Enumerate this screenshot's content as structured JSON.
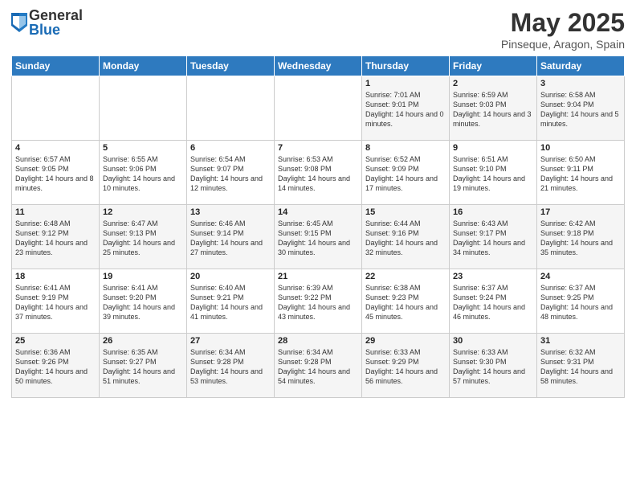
{
  "logo": {
    "general": "General",
    "blue": "Blue"
  },
  "title": "May 2025",
  "subtitle": "Pinseque, Aragon, Spain",
  "weekdays": [
    "Sunday",
    "Monday",
    "Tuesday",
    "Wednesday",
    "Thursday",
    "Friday",
    "Saturday"
  ],
  "weeks": [
    [
      {
        "day": "",
        "sunrise": "",
        "sunset": "",
        "daylight": ""
      },
      {
        "day": "",
        "sunrise": "",
        "sunset": "",
        "daylight": ""
      },
      {
        "day": "",
        "sunrise": "",
        "sunset": "",
        "daylight": ""
      },
      {
        "day": "",
        "sunrise": "",
        "sunset": "",
        "daylight": ""
      },
      {
        "day": "1",
        "sunrise": "Sunrise: 7:01 AM",
        "sunset": "Sunset: 9:01 PM",
        "daylight": "Daylight: 14 hours and 0 minutes."
      },
      {
        "day": "2",
        "sunrise": "Sunrise: 6:59 AM",
        "sunset": "Sunset: 9:03 PM",
        "daylight": "Daylight: 14 hours and 3 minutes."
      },
      {
        "day": "3",
        "sunrise": "Sunrise: 6:58 AM",
        "sunset": "Sunset: 9:04 PM",
        "daylight": "Daylight: 14 hours and 5 minutes."
      }
    ],
    [
      {
        "day": "4",
        "sunrise": "Sunrise: 6:57 AM",
        "sunset": "Sunset: 9:05 PM",
        "daylight": "Daylight: 14 hours and 8 minutes."
      },
      {
        "day": "5",
        "sunrise": "Sunrise: 6:55 AM",
        "sunset": "Sunset: 9:06 PM",
        "daylight": "Daylight: 14 hours and 10 minutes."
      },
      {
        "day": "6",
        "sunrise": "Sunrise: 6:54 AM",
        "sunset": "Sunset: 9:07 PM",
        "daylight": "Daylight: 14 hours and 12 minutes."
      },
      {
        "day": "7",
        "sunrise": "Sunrise: 6:53 AM",
        "sunset": "Sunset: 9:08 PM",
        "daylight": "Daylight: 14 hours and 14 minutes."
      },
      {
        "day": "8",
        "sunrise": "Sunrise: 6:52 AM",
        "sunset": "Sunset: 9:09 PM",
        "daylight": "Daylight: 14 hours and 17 minutes."
      },
      {
        "day": "9",
        "sunrise": "Sunrise: 6:51 AM",
        "sunset": "Sunset: 9:10 PM",
        "daylight": "Daylight: 14 hours and 19 minutes."
      },
      {
        "day": "10",
        "sunrise": "Sunrise: 6:50 AM",
        "sunset": "Sunset: 9:11 PM",
        "daylight": "Daylight: 14 hours and 21 minutes."
      }
    ],
    [
      {
        "day": "11",
        "sunrise": "Sunrise: 6:48 AM",
        "sunset": "Sunset: 9:12 PM",
        "daylight": "Daylight: 14 hours and 23 minutes."
      },
      {
        "day": "12",
        "sunrise": "Sunrise: 6:47 AM",
        "sunset": "Sunset: 9:13 PM",
        "daylight": "Daylight: 14 hours and 25 minutes."
      },
      {
        "day": "13",
        "sunrise": "Sunrise: 6:46 AM",
        "sunset": "Sunset: 9:14 PM",
        "daylight": "Daylight: 14 hours and 27 minutes."
      },
      {
        "day": "14",
        "sunrise": "Sunrise: 6:45 AM",
        "sunset": "Sunset: 9:15 PM",
        "daylight": "Daylight: 14 hours and 30 minutes."
      },
      {
        "day": "15",
        "sunrise": "Sunrise: 6:44 AM",
        "sunset": "Sunset: 9:16 PM",
        "daylight": "Daylight: 14 hours and 32 minutes."
      },
      {
        "day": "16",
        "sunrise": "Sunrise: 6:43 AM",
        "sunset": "Sunset: 9:17 PM",
        "daylight": "Daylight: 14 hours and 34 minutes."
      },
      {
        "day": "17",
        "sunrise": "Sunrise: 6:42 AM",
        "sunset": "Sunset: 9:18 PM",
        "daylight": "Daylight: 14 hours and 35 minutes."
      }
    ],
    [
      {
        "day": "18",
        "sunrise": "Sunrise: 6:41 AM",
        "sunset": "Sunset: 9:19 PM",
        "daylight": "Daylight: 14 hours and 37 minutes."
      },
      {
        "day": "19",
        "sunrise": "Sunrise: 6:41 AM",
        "sunset": "Sunset: 9:20 PM",
        "daylight": "Daylight: 14 hours and 39 minutes."
      },
      {
        "day": "20",
        "sunrise": "Sunrise: 6:40 AM",
        "sunset": "Sunset: 9:21 PM",
        "daylight": "Daylight: 14 hours and 41 minutes."
      },
      {
        "day": "21",
        "sunrise": "Sunrise: 6:39 AM",
        "sunset": "Sunset: 9:22 PM",
        "daylight": "Daylight: 14 hours and 43 minutes."
      },
      {
        "day": "22",
        "sunrise": "Sunrise: 6:38 AM",
        "sunset": "Sunset: 9:23 PM",
        "daylight": "Daylight: 14 hours and 45 minutes."
      },
      {
        "day": "23",
        "sunrise": "Sunrise: 6:37 AM",
        "sunset": "Sunset: 9:24 PM",
        "daylight": "Daylight: 14 hours and 46 minutes."
      },
      {
        "day": "24",
        "sunrise": "Sunrise: 6:37 AM",
        "sunset": "Sunset: 9:25 PM",
        "daylight": "Daylight: 14 hours and 48 minutes."
      }
    ],
    [
      {
        "day": "25",
        "sunrise": "Sunrise: 6:36 AM",
        "sunset": "Sunset: 9:26 PM",
        "daylight": "Daylight: 14 hours and 50 minutes."
      },
      {
        "day": "26",
        "sunrise": "Sunrise: 6:35 AM",
        "sunset": "Sunset: 9:27 PM",
        "daylight": "Daylight: 14 hours and 51 minutes."
      },
      {
        "day": "27",
        "sunrise": "Sunrise: 6:34 AM",
        "sunset": "Sunset: 9:28 PM",
        "daylight": "Daylight: 14 hours and 53 minutes."
      },
      {
        "day": "28",
        "sunrise": "Sunrise: 6:34 AM",
        "sunset": "Sunset: 9:28 PM",
        "daylight": "Daylight: 14 hours and 54 minutes."
      },
      {
        "day": "29",
        "sunrise": "Sunrise: 6:33 AM",
        "sunset": "Sunset: 9:29 PM",
        "daylight": "Daylight: 14 hours and 56 minutes."
      },
      {
        "day": "30",
        "sunrise": "Sunrise: 6:33 AM",
        "sunset": "Sunset: 9:30 PM",
        "daylight": "Daylight: 14 hours and 57 minutes."
      },
      {
        "day": "31",
        "sunrise": "Sunrise: 6:32 AM",
        "sunset": "Sunset: 9:31 PM",
        "daylight": "Daylight: 14 hours and 58 minutes."
      }
    ]
  ]
}
